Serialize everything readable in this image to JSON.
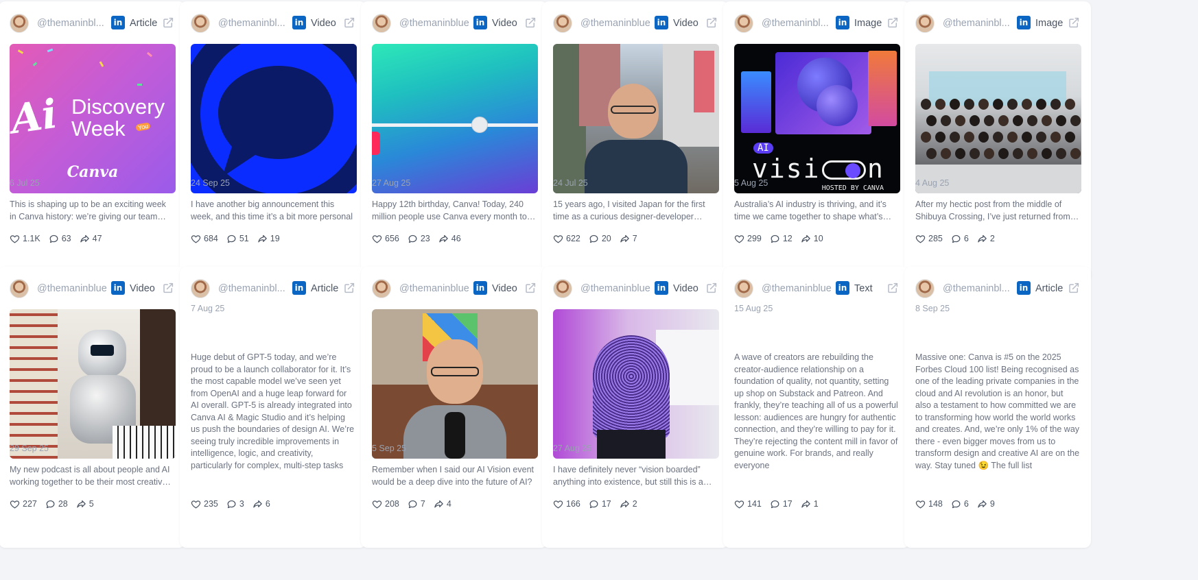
{
  "colors": {
    "linkedin": "#0a66c2",
    "background": "#f3f4f7",
    "card": "#ffffff"
  },
  "cards": [
    {
      "handle": "@themaninbl...",
      "platform_icon": "linkedin-icon",
      "type": "Article",
      "media": "ai-discovery-week",
      "media_text": "Discovery Week",
      "media_brand": "Canva",
      "media_ai": "Ai",
      "media_badge": "You",
      "date": "6 Jul 25",
      "text": "This is shaping up to be an exciting week in Canva history: we’re giving our team members around the world the chance to dive into AI",
      "likes": "1.1K",
      "comments": "63",
      "shares": "47"
    },
    {
      "handle": "@themaninbl...",
      "platform_icon": "linkedin-icon",
      "type": "Video",
      "media": "speech-bubble",
      "date": "24 Sep 25",
      "text": "I have another big announcement this week, and this time it’s a bit more personal",
      "likes": "684",
      "comments": "51",
      "shares": "19"
    },
    {
      "handle": "@themaninblue",
      "platform_icon": "linkedin-icon",
      "type": "Video",
      "media": "gradient-slider",
      "date": "27 Aug 25",
      "text": "Happy 12th birthday, Canva! Today, 240 million people use Canva every month to bring their ideas to life",
      "likes": "656",
      "comments": "23",
      "shares": "46"
    },
    {
      "handle": "@themaninblue",
      "platform_icon": "linkedin-icon",
      "type": "Video",
      "media": "shibuya-street",
      "date": "24 Jul 25",
      "text": "15 years ago, I visited Japan for the first time as a curious designer-developer looking for inspiration",
      "likes": "622",
      "comments": "20",
      "shares": "7"
    },
    {
      "handle": "@themaninbl...",
      "platform_icon": "linkedin-icon",
      "type": "Image",
      "media": "ai-vision",
      "media_ai": "AI",
      "media_text": "visi",
      "media_end": "n",
      "media_hosted": "HOSTED BY CANVA",
      "date": "5 Aug 25",
      "text": "Australia’s AI industry is thriving, and it’s time we came together to shape what’s next",
      "likes": "299",
      "comments": "12",
      "shares": "10"
    },
    {
      "handle": "@themaninbl...",
      "platform_icon": "linkedin-icon",
      "type": "Image",
      "media": "group-photo",
      "date": "4 Aug 25",
      "text": "After my hectic post from the middle of Shibuya Crossing, I’ve just returned from Tokyo",
      "likes": "285",
      "comments": "6",
      "shares": "2"
    },
    {
      "handle": "@themaninblue",
      "platform_icon": "linkedin-icon",
      "type": "Video",
      "media": "robot-piano",
      "date": "29 Sep 25",
      "text": "My new podcast is all about people and AI working together to be their most creative selves",
      "likes": "227",
      "comments": "28",
      "shares": "5"
    },
    {
      "handle": "@themaninbl...",
      "platform_icon": "linkedin-icon",
      "type": "Article",
      "media": null,
      "date": "7 Aug 25",
      "text": "Huge debut of GPT-5 today, and we’re proud to be a launch collaborator for it. It’s the most capable model we’ve seen yet from OpenAI and a huge leap forward for AI overall. GPT-5 is already integrated into Canva AI & Magic Studio and it’s helping us push the boundaries of design AI. We’re seeing truly incredible improvements in intelligence, logic, and creativity, particularly for complex, multi-step tasks",
      "likes": "235",
      "comments": "3",
      "shares": "6"
    },
    {
      "handle": "@themaninblue",
      "platform_icon": "linkedin-icon",
      "type": "Video",
      "media": "talking-head",
      "date": "5 Sep 25",
      "text": "Remember when I said our AI Vision event would be a deep dive into the future of AI?",
      "likes": "208",
      "comments": "7",
      "shares": "4"
    },
    {
      "handle": "@themaninblue",
      "platform_icon": "linkedin-icon",
      "type": "Video",
      "media": "microphone",
      "date": "27 Aug 25",
      "text": "I have definitely never “vision boarded” anything into existence, but still this is a dream come true",
      "likes": "166",
      "comments": "17",
      "shares": "2"
    },
    {
      "handle": "@themaninblue",
      "platform_icon": "linkedin-icon",
      "type": "Text",
      "media": null,
      "date": "15 Aug 25",
      "text": "A wave of creators are rebuilding the creator-audience relationship on a foundation of quality, not quantity, setting up shop on Substack and Patreon. And frankly, they’re teaching all of us a powerful lesson: audiences are hungry for authentic connection, and they’re willing to pay for it. They’re rejecting the content mill in favor of genuine work. For brands, and really everyone",
      "likes": "141",
      "comments": "17",
      "shares": "1"
    },
    {
      "handle": "@themaninbl...",
      "platform_icon": "linkedin-icon",
      "type": "Article",
      "media": null,
      "date": "8 Sep 25",
      "text": "Massive one: Canva is #5 on the 2025 Forbes Cloud 100 list! Being recognised as one of the leading private companies in the cloud and AI revolution is an honor, but also a testament to how committed we are to transforming how world the world works and creates. And, we’re only 1% of the way there - even bigger moves from us to transform design and creative AI are on the way. Stay tuned 😉 The full list",
      "likes": "148",
      "comments": "6",
      "shares": "9"
    }
  ]
}
